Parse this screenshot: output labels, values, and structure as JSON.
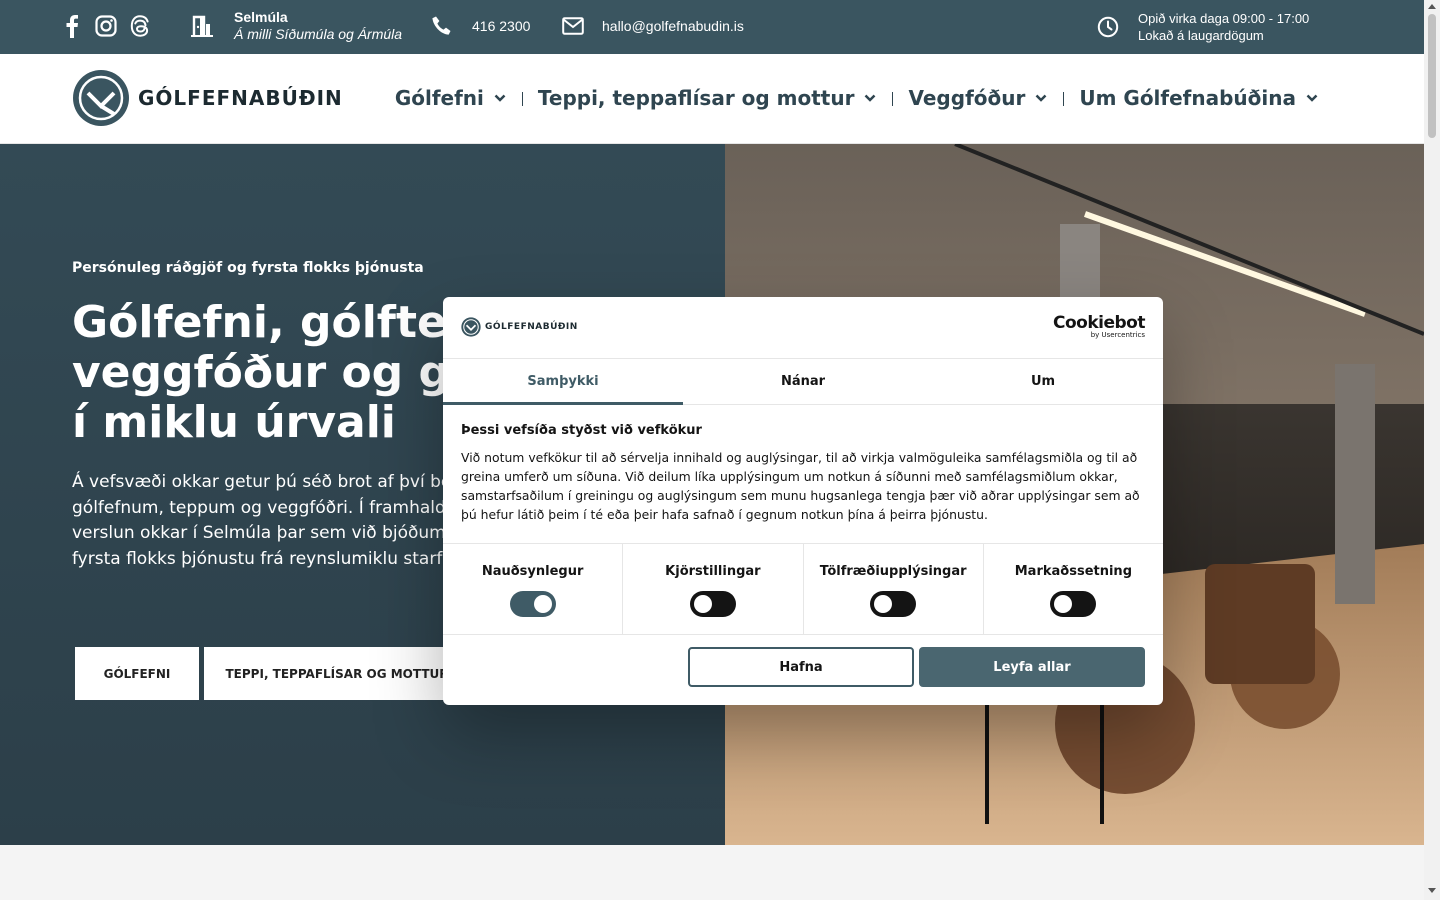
{
  "topbar": {
    "social_icons": [
      "facebook-icon",
      "instagram-icon",
      "threads-icon"
    ],
    "store_name": "Selmúla",
    "store_address": "Á milli Síðumúla og Ármúla",
    "phone": "416 2300",
    "email": "hallo@golfefnabudin.is",
    "hours_line1": "Opið virka daga 09:00 - 17:00",
    "hours_line2": "Lokað á laugardögum"
  },
  "header": {
    "logo_text": "GÓLFEFNABÚÐIN",
    "nav": [
      {
        "label": "Gólfefni"
      },
      {
        "label": "Teppi, teppaflísar og mottur"
      },
      {
        "label": "Veggfóður"
      },
      {
        "label": "Um Gólfefnabúðina"
      }
    ]
  },
  "hero": {
    "kicker": "Persónuleg ráðgjöf og fyrsta flokks þjónusta",
    "title": "Gólfefni, gólfteppi, veggfóður og gólfmottur í miklu úrvali",
    "text": "Á vefsvæði okkar getur þú séð brot af því besta sem við höfum upp á í gólfefnum, teppum og veggfóðri. Í framhaldi hvetjum við þig að líta við í verslun okkar í Selmúla þar sem við bjóðum upp á persónulega ráðgjöf og fyrsta flokks þjónustu frá reynslumiklu starfsfólki.",
    "buttons": [
      "GÓLFEFNI",
      "TEPPI, TEPPAFLÍSAR OG MOTTUR"
    ]
  },
  "cookie": {
    "logo_text": "GÓLFEFNABÚÐIN",
    "brand": "Cookiebot",
    "brand_sub": "by Usercentrics",
    "tabs": [
      {
        "label": "Samþykki",
        "active": true
      },
      {
        "label": "Nánar",
        "active": false
      },
      {
        "label": "Um",
        "active": false
      }
    ],
    "title": "Þessi vefsíða styðst við vefkökur",
    "description": "Við notum vefkökur til að sérvelja innihald og auglýsingar, til að virkja valmöguleika samfélagsmiðla og til að greina umferð um síðuna. Við deilum líka upplýsingum um notkun á síðunni með samfélagsmiðlum okkar, samstarfsaðilum í greiningu og auglýsingum sem munu hugsanlega tengja þær við aðrar upplýsingar sem að þú hefur látið þeim í té eða þeir hafa safnað í gegnum notkun þína á þeirra þjónustu.",
    "categories": [
      {
        "label": "Nauðsynlegur",
        "enabled": true
      },
      {
        "label": "Kjörstillingar",
        "enabled": false
      },
      {
        "label": "Tölfræðiupplýsingar",
        "enabled": false
      },
      {
        "label": "Markaðssetning",
        "enabled": false
      }
    ],
    "decline_label": "Hafna",
    "allow_label": "Leyfa allar"
  },
  "colors": {
    "topbar": "#3a5560",
    "brand_dark": "#2f4550",
    "accent": "#4a6670"
  }
}
